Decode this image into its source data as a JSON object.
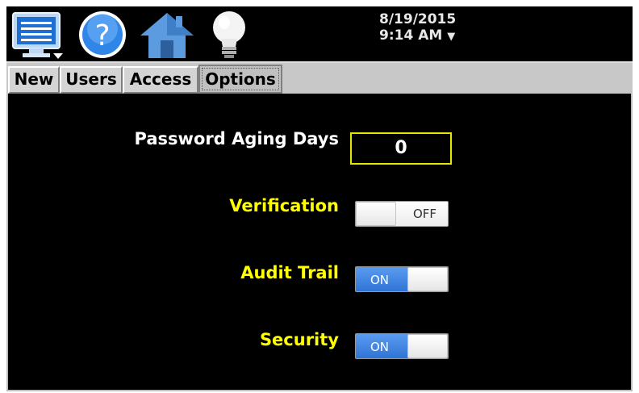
{
  "header": {
    "date": "8/19/2015",
    "time": "9:14 AM",
    "time_caret": "▼",
    "icons": [
      "monitor-menu-icon",
      "help-icon",
      "home-icon",
      "lightbulb-icon"
    ]
  },
  "tabs": [
    {
      "label": "New"
    },
    {
      "label": "Users"
    },
    {
      "label": "Access"
    },
    {
      "label": "Options",
      "selected": true
    }
  ],
  "options": {
    "password_aging_label": "Password Aging Days",
    "password_aging_value": "0",
    "verification_label": "Verification",
    "verification_state": "OFF",
    "audit_trail_label": "Audit Trail",
    "audit_trail_state": "ON",
    "security_label": "Security",
    "security_state": "ON"
  },
  "colors": {
    "background": "#000000",
    "label_yellow": "#ffff00",
    "toggle_on": "#3a7fe0",
    "field_border": "#e6e600"
  }
}
